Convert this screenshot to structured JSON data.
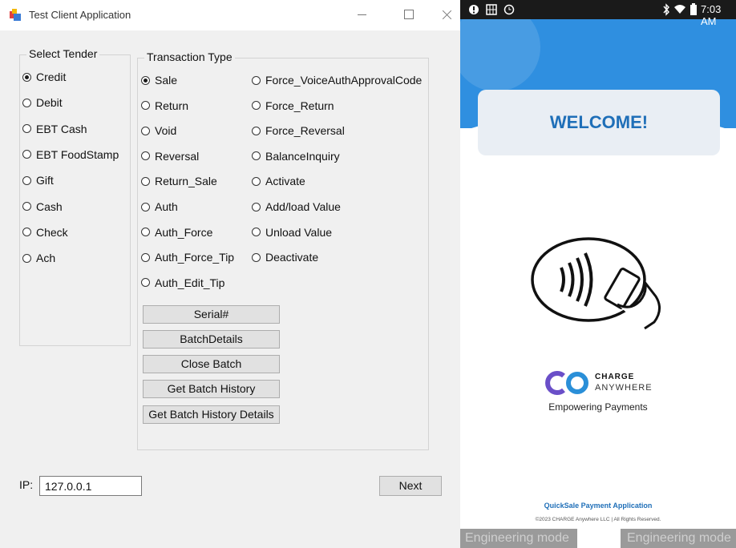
{
  "window": {
    "title": "Test Client Application",
    "controls": {
      "minimize": "minimize",
      "maximize": "maximize",
      "close": "close"
    }
  },
  "tender": {
    "legend": "Select Tender",
    "options": [
      {
        "label": "Credit",
        "checked": true
      },
      {
        "label": "Debit",
        "checked": false
      },
      {
        "label": "EBT Cash",
        "checked": false
      },
      {
        "label": "EBT FoodStamp",
        "checked": false
      },
      {
        "label": "Gift",
        "checked": false
      },
      {
        "label": "Cash",
        "checked": false
      },
      {
        "label": "Check",
        "checked": false
      },
      {
        "label": "Ach",
        "checked": false
      }
    ]
  },
  "transaction": {
    "legend": "Transaction Type",
    "col1": [
      {
        "label": "Sale",
        "checked": true
      },
      {
        "label": "Return",
        "checked": false
      },
      {
        "label": "Void",
        "checked": false
      },
      {
        "label": "Reversal",
        "checked": false
      },
      {
        "label": "Return_Sale",
        "checked": false
      },
      {
        "label": "Auth",
        "checked": false
      },
      {
        "label": "Auth_Force",
        "checked": false
      },
      {
        "label": "Auth_Force_Tip",
        "checked": false
      },
      {
        "label": "Auth_Edit_Tip",
        "checked": false
      }
    ],
    "col2": [
      {
        "label": "Force_VoiceAuthApprovalCode",
        "checked": false
      },
      {
        "label": "Force_Return",
        "checked": false
      },
      {
        "label": "Force_Reversal",
        "checked": false
      },
      {
        "label": "BalanceInquiry",
        "checked": false
      },
      {
        "label": "Activate",
        "checked": false
      },
      {
        "label": "Add/load Value",
        "checked": false
      },
      {
        "label": "Unload Value",
        "checked": false
      },
      {
        "label": "Deactivate",
        "checked": false
      }
    ]
  },
  "buttons": [
    {
      "label": "Serial#"
    },
    {
      "label": "BatchDetails"
    },
    {
      "label": "Close Batch"
    },
    {
      "label": "Get Batch History"
    },
    {
      "label": "Get Batch History Details"
    }
  ],
  "ip": {
    "label": "IP:",
    "value": "127.0.0.1"
  },
  "next_label": "Next",
  "device": {
    "time": "7:03 AM",
    "welcome": "WELCOME!",
    "brand_line1": "CHARGE",
    "brand_line2": "ANYWHERE",
    "tagline": "Empowering Payments",
    "app_name": "QuickSale Payment Application",
    "copyright": "©2023 CHARGE Anywhere LLC | All Rights Reserved.",
    "engineering_left": "Engineering mode",
    "engineering_right": "Engineering mode",
    "colors": {
      "primary": "#2f8fe0",
      "accent": "#1f6fb8"
    }
  }
}
